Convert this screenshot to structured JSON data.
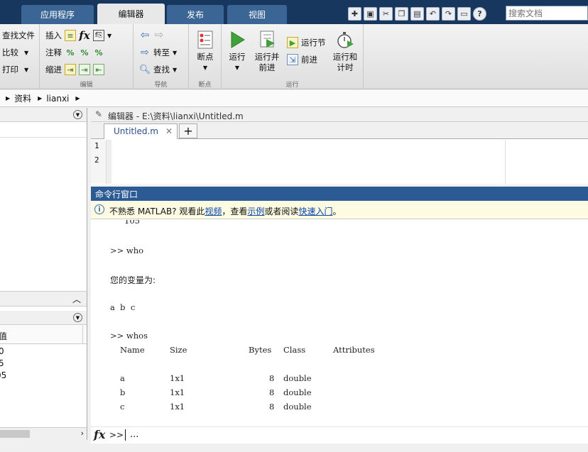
{
  "tabs": [
    {
      "label": "应用程序",
      "active": false
    },
    {
      "label": "编辑器",
      "active": true
    },
    {
      "label": "发布",
      "active": false
    },
    {
      "label": "视图",
      "active": false
    }
  ],
  "search": {
    "placeholder": "搜索文档"
  },
  "ribbon": {
    "file": {
      "find_files": "查找文件",
      "compare": "比较",
      "print": "打印"
    },
    "edit": {
      "insert": "插入",
      "comment": "注释",
      "indent": "缩进",
      "label": "编辑"
    },
    "navigate": {
      "goto": "转至",
      "find": "查找",
      "label": "导航"
    },
    "breakpoints": {
      "button": "断点",
      "label": "断点"
    },
    "run": {
      "run": "运行",
      "run_advance_1": "运行并",
      "run_advance_2": "前进",
      "run_section": "运行节",
      "advance": "前进",
      "run_time_1": "运行和",
      "run_time_2": "计时",
      "label": "运行"
    }
  },
  "address": {
    "path": [
      "资料",
      "lianxi"
    ]
  },
  "editor": {
    "title": "编辑器 - E:\\资料\\lianxi\\Untitled.m",
    "tab_label": "Untitled.m",
    "line_numbers": [
      "1",
      "2"
    ]
  },
  "command_window": {
    "title": "命令行窗口",
    "notice": {
      "prefix": "不熟悉 MATLAB? 观看此",
      "video": "视频",
      "mid1": "，查看",
      "examples": "示例",
      "mid2": "或者阅读",
      "getting_started": "快速入门",
      "end": "。"
    },
    "lines": [
      "105",
      ">> who",
      "您的变量为:",
      "a  b  c",
      ">> whos"
    ],
    "whos_header": [
      "Name",
      "Size",
      "Bytes",
      "Class",
      "Attributes"
    ],
    "whos_rows": [
      [
        "a",
        "1x1",
        "8",
        "double",
        ""
      ],
      [
        "b",
        "1x1",
        "8",
        "double",
        ""
      ],
      [
        "c",
        "1x1",
        "8",
        "double",
        ""
      ]
    ],
    "prompt": ">>",
    "input_value": "..."
  },
  "workspace": {
    "col_header": "值",
    "values": [
      "0",
      "5",
      "05"
    ]
  }
}
